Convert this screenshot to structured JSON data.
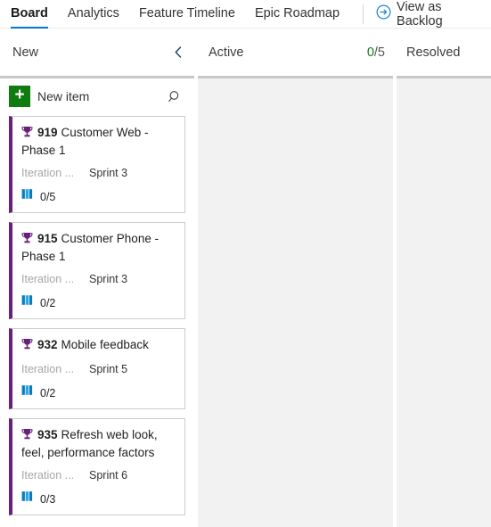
{
  "tabs": [
    {
      "label": "Board",
      "active": true
    },
    {
      "label": "Analytics",
      "active": false
    },
    {
      "label": "Feature Timeline",
      "active": false
    },
    {
      "label": "Epic Roadmap",
      "active": false
    }
  ],
  "toolbar_right": {
    "view_as_backlog_label": "View as Backlog",
    "icon": "arrow-circle-right-icon"
  },
  "columns": [
    {
      "title": "New",
      "has_collapse": true,
      "collapse_icon": "chevron-left-icon",
      "wip": null
    },
    {
      "title": "Active",
      "has_collapse": false,
      "wip": {
        "current": "0",
        "separator": "/",
        "limit": "5"
      }
    },
    {
      "title": "Resolved",
      "has_collapse": false,
      "wip": null
    }
  ],
  "new_column_toolbar": {
    "add_icon": "plus-icon",
    "new_item_label": "New item",
    "search_icon": "search-icon"
  },
  "cards": [
    {
      "type_icon": "trophy-icon",
      "id": "919",
      "title": "Customer Web - Phase 1",
      "field_label": "Iteration ...",
      "field_value": "Sprint 3",
      "children_icon": "book-icon",
      "children_count": "0/5"
    },
    {
      "type_icon": "trophy-icon",
      "id": "915",
      "title": "Customer Phone - Phase 1",
      "field_label": "Iteration ...",
      "field_value": "Sprint 3",
      "children_icon": "book-icon",
      "children_count": "0/2"
    },
    {
      "type_icon": "trophy-icon",
      "id": "932",
      "title": "Mobile feedback",
      "field_label": "Iteration ...",
      "field_value": "Sprint 5",
      "children_icon": "book-icon",
      "children_count": "0/2"
    },
    {
      "type_icon": "trophy-icon",
      "id": "935",
      "title": "Refresh web look, feel, performance factors",
      "field_label": "Iteration ...",
      "field_value": "Sprint 6",
      "children_icon": "book-icon",
      "children_count": "0/3"
    }
  ],
  "colors": {
    "accent": "#0078d4",
    "epic_purple": "#68217a",
    "add_green": "#107c10",
    "wip_ok_green": "#107c10",
    "column_bg": "#f2f2f2",
    "card_border": "#cccccc"
  }
}
